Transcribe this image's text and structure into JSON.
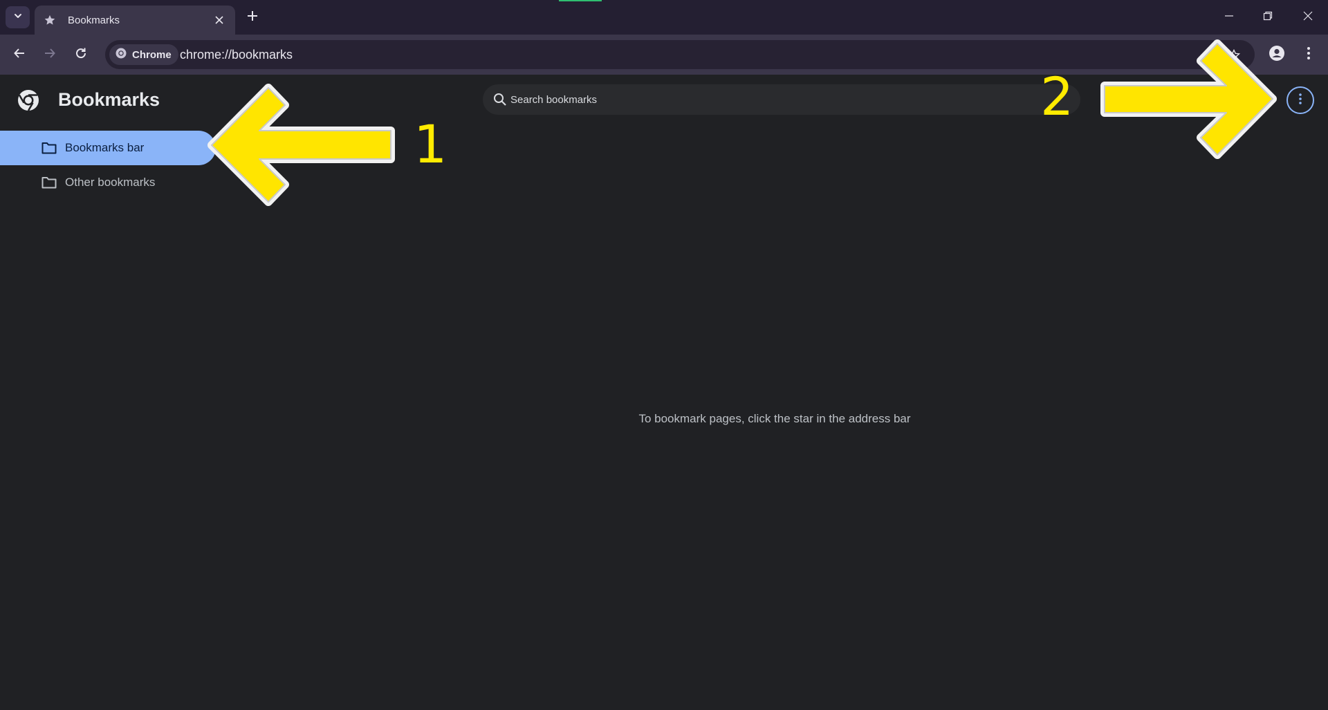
{
  "browser": {
    "tab": {
      "title": "Bookmarks",
      "favicon": "star-icon"
    },
    "omnibox": {
      "chip_label": "Chrome",
      "url": "chrome://bookmarks"
    }
  },
  "page": {
    "title": "Bookmarks",
    "search_placeholder": "Search bookmarks",
    "sidebar": [
      {
        "label": "Bookmarks bar",
        "selected": true,
        "icon": "folder-icon"
      },
      {
        "label": "Other bookmarks",
        "selected": false,
        "icon": "folder-icon"
      }
    ],
    "empty_message": "To bookmark pages, click the star in the address bar"
  },
  "annotations": [
    {
      "number": "1",
      "color": "#ffeb00"
    },
    {
      "number": "2",
      "color": "#ffeb00"
    }
  ],
  "colors": {
    "accent": "#8ab4f8",
    "page_background": "#202124",
    "tabstrip": "#241f32",
    "toolbar": "#3b364a",
    "annotation": "#ffeb00"
  }
}
